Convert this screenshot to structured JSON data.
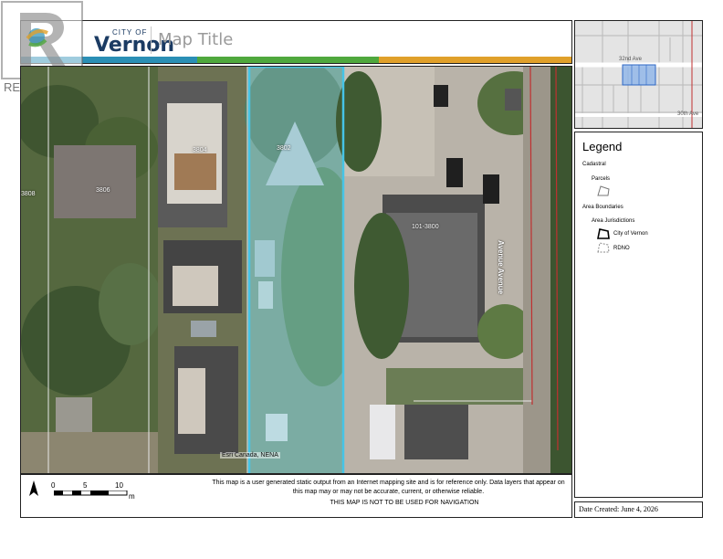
{
  "header": {
    "city_small": "CITY OF",
    "city_name": "Vernon",
    "map_title": "Map Title",
    "realtor_label": "REALTOR®",
    "brand_colors": [
      "#2a8fb5",
      "#4fa83d",
      "#e0a02a"
    ]
  },
  "map": {
    "parcel_labels": [
      "3808",
      "3806",
      "3804",
      "3802",
      "101-3800"
    ],
    "attribution": "Esri Canada, NENA",
    "street_label": "Avenue Avenue"
  },
  "overview": {
    "street_top": "32nd Ave",
    "street_bottom": "30th Ave"
  },
  "legend": {
    "title": "Legend",
    "cadastral": "Cadastral",
    "parcels": "Parcels",
    "area_boundaries": "Area Boundaries",
    "area_jurisdictions": "Area Jurisdictions",
    "city_of_vernon": "City of Vernon",
    "rdno": "RDNO"
  },
  "footer": {
    "disclaimer": "This map is a user generated static output from an Internet mapping site and is for reference only. Data layers that appear on this map may or may not be accurate, current, or otherwise reliable.",
    "nav_note": "THIS MAP IS NOT TO BE USED FOR NAVIGATION",
    "scale": {
      "labels": [
        "0",
        "5",
        "10"
      ],
      "unit": "m"
    },
    "north_label": "A",
    "date_created": "Date Created: June 4, 2026"
  }
}
